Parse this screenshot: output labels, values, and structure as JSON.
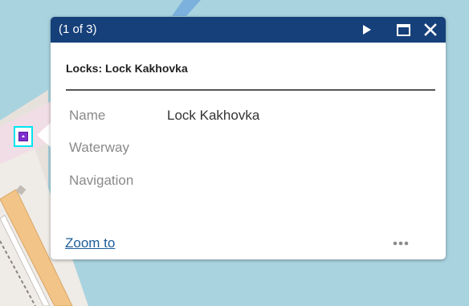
{
  "colors": {
    "water": "#a9d3df",
    "land": "#ece6e0",
    "road": "#f2c487",
    "header": "#16407a",
    "marker": "#7e2fd0",
    "highlight": "#00e5ef",
    "link": "#1c5d99"
  },
  "popup": {
    "counter": "(1 of 3)",
    "title": "Locks: Lock Kakhovka",
    "actions": {
      "next_icon": "play-triangle-icon",
      "maximize_icon": "maximize-window-icon",
      "close_icon": "close-x-icon"
    },
    "attributes": [
      {
        "label": "Name",
        "value": "Lock Kakhovka"
      },
      {
        "label": "Waterway",
        "value": ""
      },
      {
        "label": "Navigation",
        "value": ""
      }
    ],
    "zoom_label": "Zoom to",
    "more_icon": "ellipsis-icon"
  },
  "map": {
    "marker_icon": "lock-triangle-marker-icon"
  }
}
